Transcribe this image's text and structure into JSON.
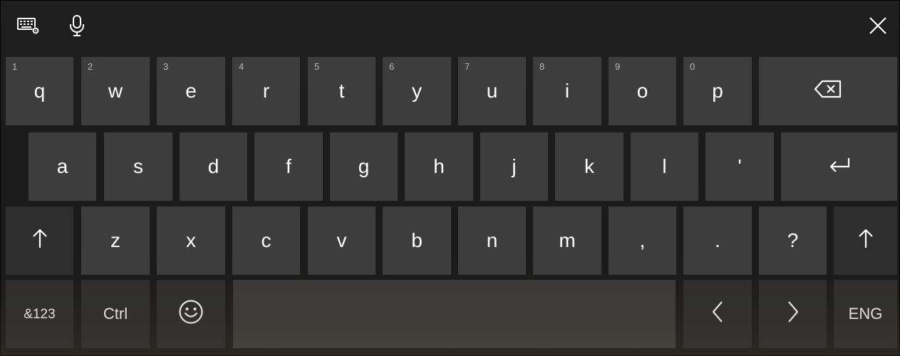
{
  "toolbar": {
    "keyboard_settings_icon": "keyboard-settings-icon",
    "microphone_icon": "microphone-icon",
    "close_icon": "close-icon"
  },
  "row1": {
    "keys": [
      {
        "num": "1",
        "label": "q"
      },
      {
        "num": "2",
        "label": "w"
      },
      {
        "num": "3",
        "label": "e"
      },
      {
        "num": "4",
        "label": "r"
      },
      {
        "num": "5",
        "label": "t"
      },
      {
        "num": "6",
        "label": "y"
      },
      {
        "num": "7",
        "label": "u"
      },
      {
        "num": "8",
        "label": "i"
      },
      {
        "num": "9",
        "label": "o"
      },
      {
        "num": "0",
        "label": "p"
      }
    ],
    "backspace_icon": "backspace-icon"
  },
  "row2": {
    "keys": [
      {
        "label": "a"
      },
      {
        "label": "s"
      },
      {
        "label": "d"
      },
      {
        "label": "f"
      },
      {
        "label": "g"
      },
      {
        "label": "h"
      },
      {
        "label": "j"
      },
      {
        "label": "k"
      },
      {
        "label": "l"
      },
      {
        "label": "'"
      }
    ],
    "enter_icon": "enter-icon"
  },
  "row3": {
    "shift_icon": "shift-icon",
    "keys": [
      {
        "label": "z"
      },
      {
        "label": "x"
      },
      {
        "label": "c"
      },
      {
        "label": "v"
      },
      {
        "label": "b"
      },
      {
        "label": "n"
      },
      {
        "label": "m"
      },
      {
        "label": ","
      },
      {
        "label": "."
      },
      {
        "label": "?"
      }
    ]
  },
  "row4": {
    "symbols_label": "&123",
    "ctrl_label": "Ctrl",
    "emoji_icon": "emoji-icon",
    "left_icon": "chevron-left-icon",
    "right_icon": "chevron-right-icon",
    "language_label": "ENG"
  },
  "colors": {
    "key": "#3d3d3d",
    "key_dark": "#2e2e2e",
    "background": "#1a1a1a",
    "number_hint": "#b8b8b8"
  }
}
